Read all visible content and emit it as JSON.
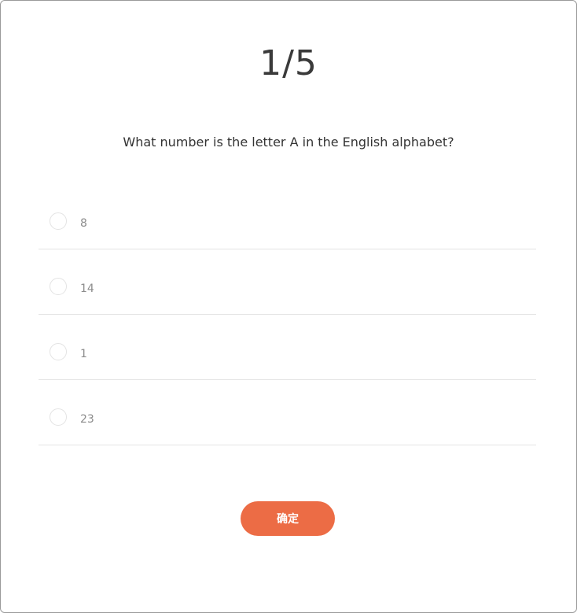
{
  "quiz": {
    "progress": "1/5",
    "question": "What number is the letter A in the English alphabet?",
    "options": [
      {
        "label": "8",
        "selected": false
      },
      {
        "label": "14",
        "selected": false
      },
      {
        "label": "1",
        "selected": false
      },
      {
        "label": "23",
        "selected": false
      }
    ],
    "confirm_label": "确定"
  },
  "colors": {
    "accent": "#ec6c45",
    "title_text": "#3a3a3a",
    "option_text": "#8c8c8c",
    "divider": "#e4e4e4"
  }
}
